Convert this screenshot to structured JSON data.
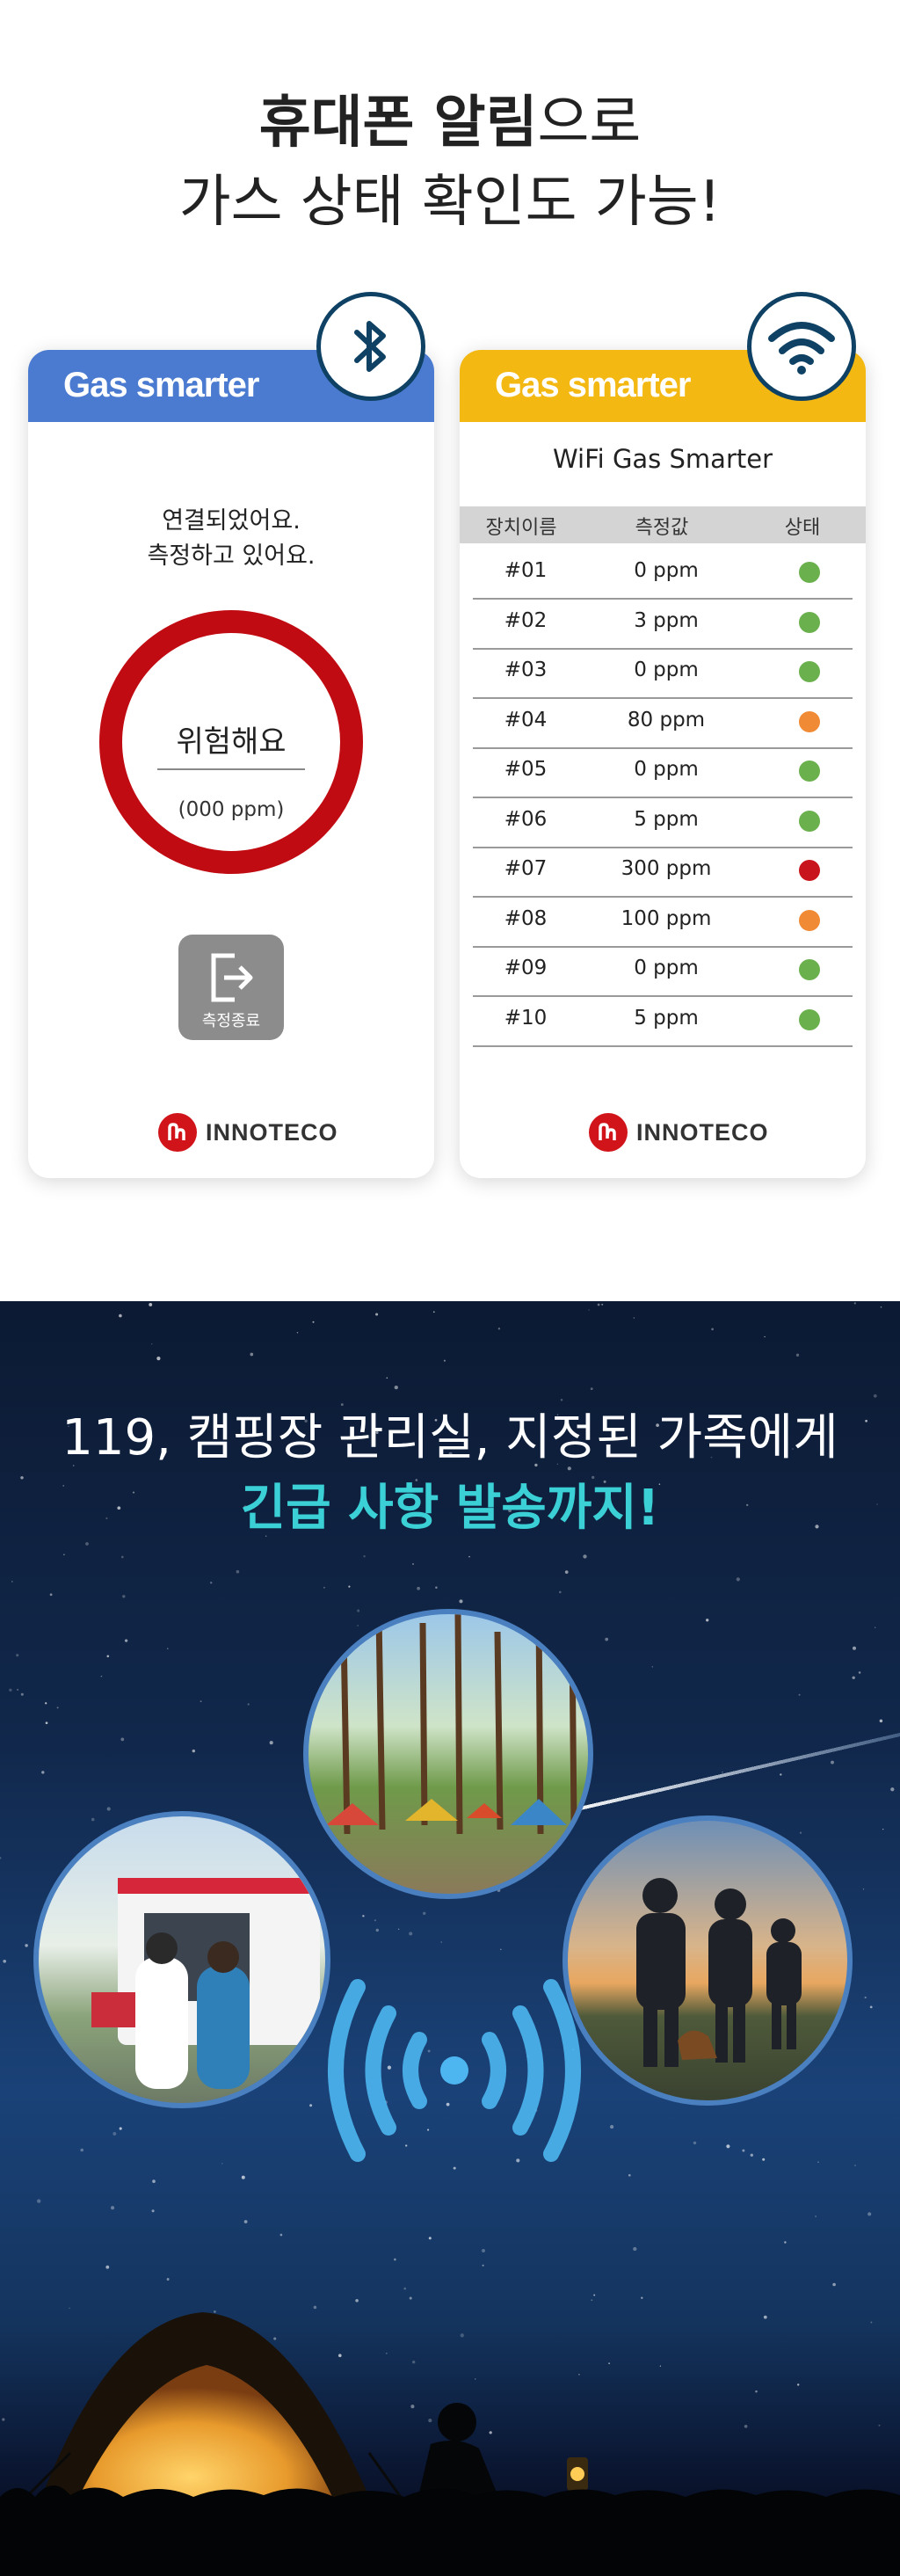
{
  "header": {
    "line1_bold": "휴대폰 알림",
    "line1_rest": "으로",
    "line2": "가스 상태 확인도 가능!"
  },
  "bluetooth_card": {
    "app_title": "Gas smarter",
    "header_color": "#4a7bd0",
    "status_line1": "연결되었어요.",
    "status_line2": "측정하고 있어요.",
    "ring_title": "위험해요",
    "ring_value": "(000 ppm)",
    "stop_button_label": "측정종료",
    "brand": "INNOTECO",
    "icon": "bluetooth-icon"
  },
  "wifi_card": {
    "app_title": "Gas smarter",
    "header_color": "#f4b813",
    "screen_title": "WiFi Gas Smarter",
    "columns": [
      "장치이름",
      "측정값",
      "상태"
    ],
    "rows": [
      {
        "device": "#01",
        "value": "0 ppm",
        "status": "normal"
      },
      {
        "device": "#02",
        "value": "3 ppm",
        "status": "normal"
      },
      {
        "device": "#03",
        "value": "0 ppm",
        "status": "normal"
      },
      {
        "device": "#04",
        "value": "80 ppm",
        "status": "warning"
      },
      {
        "device": "#05",
        "value": "0 ppm",
        "status": "normal"
      },
      {
        "device": "#06",
        "value": "5 ppm",
        "status": "normal"
      },
      {
        "device": "#07",
        "value": "300 ppm",
        "status": "danger"
      },
      {
        "device": "#08",
        "value": "100 ppm",
        "status": "warning"
      },
      {
        "device": "#09",
        "value": "0 ppm",
        "status": "normal"
      },
      {
        "device": "#10",
        "value": "5 ppm",
        "status": "normal"
      }
    ],
    "status_colors": {
      "normal": "#6ab04c",
      "warning": "#f08a34",
      "danger": "#c8141c"
    },
    "brand": "INNOTECO",
    "icon": "wifi-icon"
  },
  "emergency": {
    "line1": "119, 캠핑장 관리실, 지정된 가족에게",
    "line2": "긴급 사항 발송까지!",
    "accent_color": "#3ad0d6",
    "photos": [
      "campsite-photo",
      "ambulance-photo",
      "family-photo"
    ],
    "signal_icon": "broadcast-signal-icon"
  }
}
